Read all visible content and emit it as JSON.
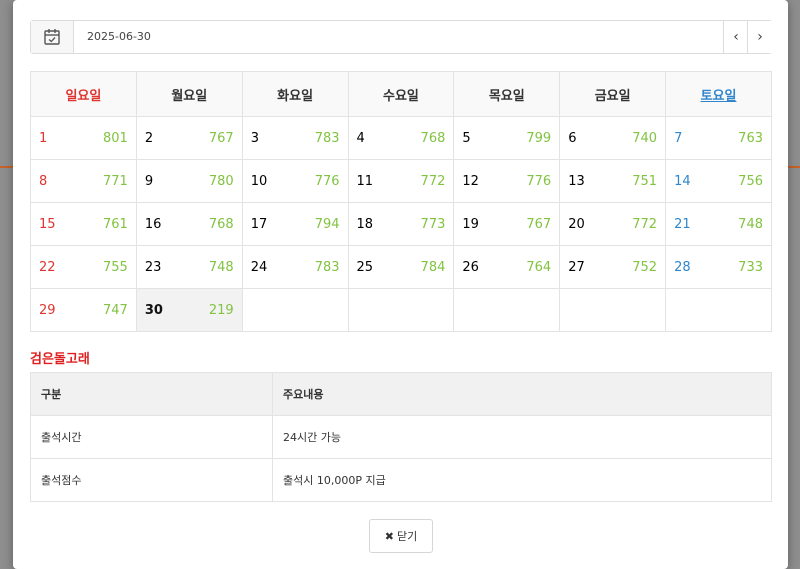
{
  "date_picker": {
    "value": "2025-06-30",
    "prev_glyph": "‹",
    "next_glyph": "›"
  },
  "calendar": {
    "weekdays": [
      "일요일",
      "월요일",
      "화요일",
      "수요일",
      "목요일",
      "금요일",
      "토요일"
    ],
    "weeks": [
      [
        {
          "d": "1",
          "v": "801"
        },
        {
          "d": "2",
          "v": "767"
        },
        {
          "d": "3",
          "v": "783"
        },
        {
          "d": "4",
          "v": "768"
        },
        {
          "d": "5",
          "v": "799"
        },
        {
          "d": "6",
          "v": "740"
        },
        {
          "d": "7",
          "v": "763"
        }
      ],
      [
        {
          "d": "8",
          "v": "771"
        },
        {
          "d": "9",
          "v": "780"
        },
        {
          "d": "10",
          "v": "776"
        },
        {
          "d": "11",
          "v": "772"
        },
        {
          "d": "12",
          "v": "776"
        },
        {
          "d": "13",
          "v": "751"
        },
        {
          "d": "14",
          "v": "756"
        }
      ],
      [
        {
          "d": "15",
          "v": "761"
        },
        {
          "d": "16",
          "v": "768"
        },
        {
          "d": "17",
          "v": "794"
        },
        {
          "d": "18",
          "v": "773"
        },
        {
          "d": "19",
          "v": "767"
        },
        {
          "d": "20",
          "v": "772"
        },
        {
          "d": "21",
          "v": "748"
        }
      ],
      [
        {
          "d": "22",
          "v": "755"
        },
        {
          "d": "23",
          "v": "748"
        },
        {
          "d": "24",
          "v": "783"
        },
        {
          "d": "25",
          "v": "784"
        },
        {
          "d": "26",
          "v": "764"
        },
        {
          "d": "27",
          "v": "752"
        },
        {
          "d": "28",
          "v": "733"
        }
      ],
      [
        {
          "d": "29",
          "v": "747"
        },
        {
          "d": "30",
          "v": "219"
        },
        {
          "d": "",
          "v": ""
        },
        {
          "d": "",
          "v": ""
        },
        {
          "d": "",
          "v": ""
        },
        {
          "d": "",
          "v": ""
        },
        {
          "d": "",
          "v": ""
        }
      ]
    ],
    "today": "30"
  },
  "section_title": "검은돌고래",
  "info_table": {
    "headers": [
      "구분",
      "주요내용"
    ],
    "rows": [
      [
        "출석시간",
        "24시간 가능"
      ],
      [
        "출석점수",
        "출석시 10,000P 지급"
      ]
    ]
  },
  "close_button": {
    "icon_glyph": "✖",
    "label": "닫기"
  }
}
